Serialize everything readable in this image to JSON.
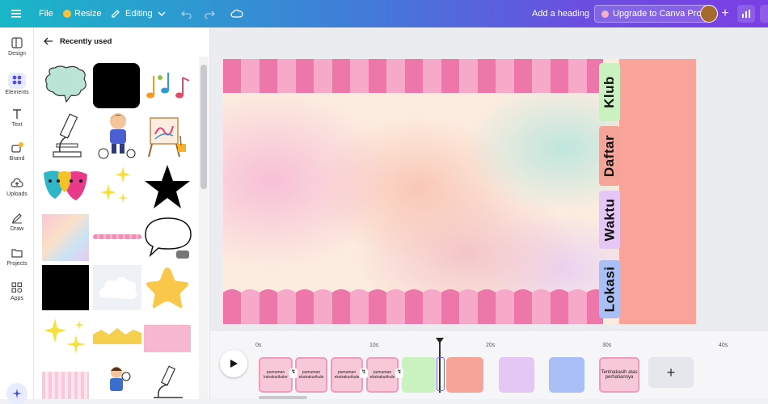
{
  "topbar": {
    "file_label": "File",
    "resize_label": "Resize",
    "editing_label": "Editing",
    "add_heading_label": "Add a heading",
    "upgrade_label": "Upgrade to Canva Pro"
  },
  "rail": {
    "items": [
      {
        "label": "Design",
        "icon": "layout-icon"
      },
      {
        "label": "Elements",
        "icon": "shapes-icon"
      },
      {
        "label": "Text",
        "icon": "text-icon"
      },
      {
        "label": "Brand",
        "icon": "brand-icon"
      },
      {
        "label": "Uploads",
        "icon": "cloud-upload-icon"
      },
      {
        "label": "Draw",
        "icon": "pen-icon"
      },
      {
        "label": "Projects",
        "icon": "folder-icon"
      },
      {
        "label": "Apps",
        "icon": "apps-icon"
      }
    ]
  },
  "panel": {
    "title": "Recently used"
  },
  "canvas": {
    "tabs": [
      {
        "label": "Klub",
        "color": "#c9f2c0"
      },
      {
        "label": "Daftar",
        "color": "#f6a39a"
      },
      {
        "label": "Waktu",
        "color": "#e5c7f5"
      },
      {
        "label": "Lokasi",
        "color": "#a9bff5"
      }
    ],
    "side_color": "#f9a39a"
  },
  "timeline": {
    "ticks": [
      "0s",
      "10s",
      "20s",
      "30s",
      "40s"
    ],
    "clips": [
      {
        "text": "pumuman kstrakurikuler"
      },
      {
        "text": "pumuman ekstrakurikule"
      },
      {
        "text": "pumuman ekstrakurikule"
      },
      {
        "text": "pumuman ekstrakurikule"
      },
      {
        "text": ""
      },
      {
        "text": ""
      },
      {
        "text": ""
      },
      {
        "text": ""
      },
      {
        "text": "Terimakasih atas perhatiannya"
      }
    ],
    "add_label": "+"
  }
}
